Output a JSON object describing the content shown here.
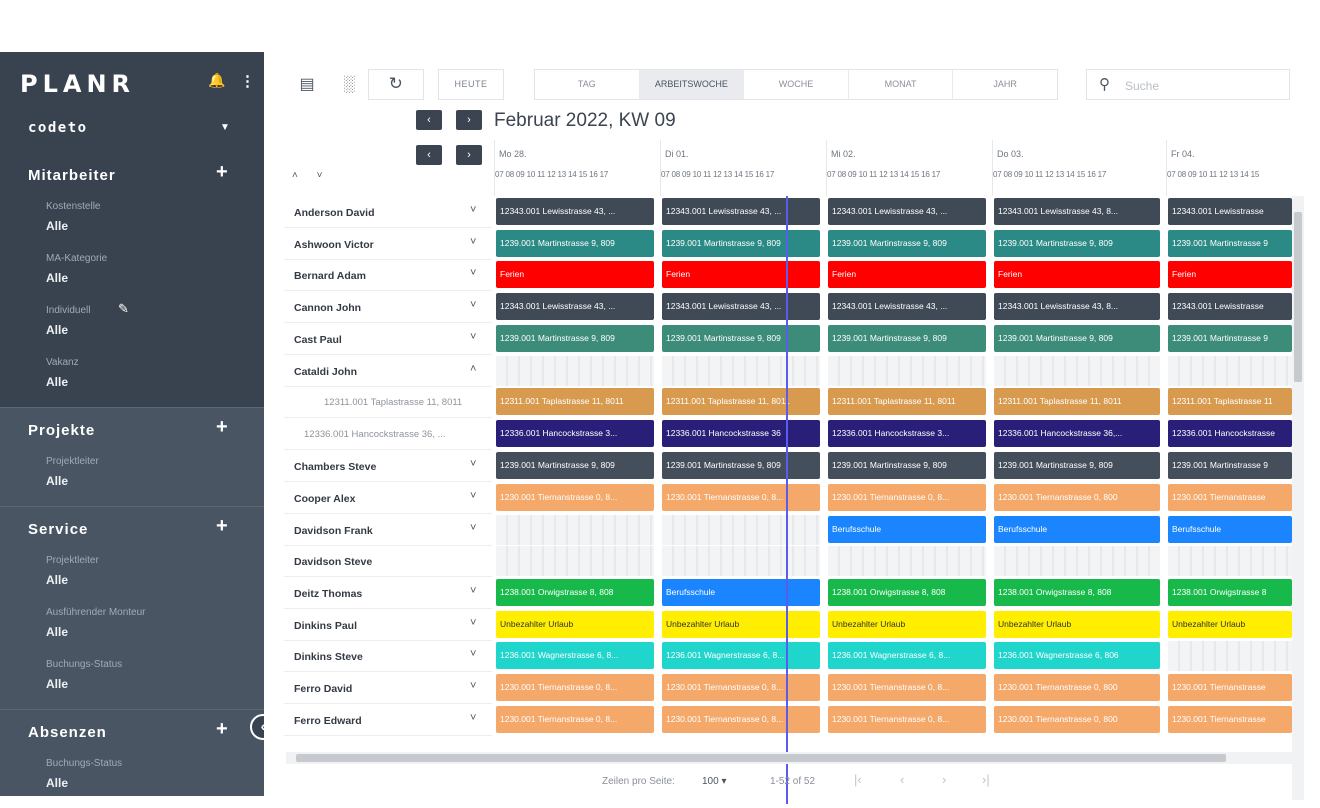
{
  "sidebar": {
    "logo": "PLANR",
    "company": "codeto",
    "sections": [
      {
        "title": "Mitarbeiter",
        "filters": [
          {
            "label": "Kostenstelle",
            "value": "Alle"
          },
          {
            "label": "MA-Kategorie",
            "value": "Alle"
          },
          {
            "label": "Individuell",
            "value": "Alle"
          },
          {
            "label": "Vakanz",
            "value": "Alle"
          }
        ]
      },
      {
        "title": "Projekte",
        "filters": [
          {
            "label": "Projektleiter",
            "value": "Alle"
          }
        ]
      },
      {
        "title": "Service",
        "filters": [
          {
            "label": "Projektleiter",
            "value": "Alle"
          },
          {
            "label": "Ausführender Monteur",
            "value": "Alle"
          },
          {
            "label": "Buchungs-Status",
            "value": "Alle"
          }
        ]
      },
      {
        "title": "Absenzen",
        "filters": [
          {
            "label": "Buchungs-Status",
            "value": "Alle"
          }
        ]
      }
    ]
  },
  "toolbar": {
    "today": "HEUTE",
    "views": [
      "TAG",
      "ARBEITSWOCHE",
      "WOCHE",
      "MONAT",
      "JAHR"
    ],
    "active_view": "ARBEITSWOCHE",
    "search_placeholder": "Suche"
  },
  "period_title": "Februar 2022, KW 09",
  "days": [
    {
      "name": "Mo 28."
    },
    {
      "name": "Di 01."
    },
    {
      "name": "Mi 02."
    },
    {
      "name": "Do 03."
    },
    {
      "name": "Fr 04."
    }
  ],
  "hours_row": "07 08 09 10  11  12  13  14  15  16  17",
  "hours_row_last": "07 08 09 10  11  12  13  14  15",
  "rows": [
    {
      "name": "Anderson David",
      "type": "emp",
      "chev": "down",
      "bars": [
        {
          "text": "12343.001 Lewisstrasse 43, ...",
          "color": "#3f4a56"
        },
        {
          "text": "12343.001 Lewisstrasse 43, ...",
          "color": "#3f4a56"
        },
        {
          "text": "12343.001 Lewisstrasse 43, ...",
          "color": "#3f4a56"
        },
        {
          "text": "12343.001 Lewisstrasse 43, 8...",
          "color": "#3f4a56"
        },
        {
          "text": "12343.001 Lewisstrasse",
          "color": "#3f4a56"
        }
      ]
    },
    {
      "name": "Ashwoon Victor",
      "type": "emp",
      "chev": "down",
      "bars": [
        {
          "text": "1239.001 Martinstrasse 9, 809",
          "color": "#2b8a86"
        },
        {
          "text": "1239.001 Martinstrasse 9, 809",
          "color": "#2b8a86"
        },
        {
          "text": "1239.001 Martinstrasse 9, 809",
          "color": "#2b8a86"
        },
        {
          "text": "1239.001 Martinstrasse 9, 809",
          "color": "#2b8a86"
        },
        {
          "text": "1239.001 Martinstrasse 9",
          "color": "#2b8a86"
        }
      ]
    },
    {
      "name": "Bernard Adam",
      "type": "emp",
      "chev": "down",
      "bars": [
        {
          "text": "Ferien",
          "color": "#ff0000"
        },
        {
          "text": "Ferien",
          "color": "#ff0000"
        },
        {
          "text": "Ferien",
          "color": "#ff0000"
        },
        {
          "text": "Ferien",
          "color": "#ff0000"
        },
        {
          "text": "Ferien",
          "color": "#ff0000"
        }
      ]
    },
    {
      "name": "Cannon John",
      "type": "emp",
      "chev": "down",
      "bars": [
        {
          "text": "12343.001 Lewisstrasse 43, ...",
          "color": "#3f4a56"
        },
        {
          "text": "12343.001 Lewisstrasse 43, ...",
          "color": "#3f4a56"
        },
        {
          "text": "12343.001 Lewisstrasse 43, ...",
          "color": "#3f4a56"
        },
        {
          "text": "12343.001 Lewisstrasse 43, 8...",
          "color": "#3f4a56"
        },
        {
          "text": "12343.001 Lewisstrasse",
          "color": "#3f4a56"
        }
      ]
    },
    {
      "name": "Cast Paul",
      "type": "emp",
      "chev": "down",
      "bars": [
        {
          "text": "1239.001 Martinstrasse 9, 809",
          "color": "#3d8c7a"
        },
        {
          "text": "1239.001 Martinstrasse 9, 809",
          "color": "#3d8c7a"
        },
        {
          "text": "1239.001 Martinstrasse 9, 809",
          "color": "#3d8c7a"
        },
        {
          "text": "1239.001 Martinstrasse 9, 809",
          "color": "#3d8c7a"
        },
        {
          "text": "1239.001 Martinstrasse 9",
          "color": "#3d8c7a"
        }
      ]
    },
    {
      "name": "Cataldi John",
      "type": "emp",
      "chev": "up",
      "bars": []
    },
    {
      "name": "12311.001 Taplastrasse 11, 8011",
      "type": "sub",
      "bars": [
        {
          "text": "12311.001 Taplastrasse 11, 8011",
          "color": "#d89a4e"
        },
        {
          "text": "12311.001 Taplastrasse 11, 8011",
          "color": "#d89a4e"
        },
        {
          "text": "12311.001 Taplastrasse 11, 8011",
          "color": "#d89a4e"
        },
        {
          "text": "12311.001 Taplastrasse 11, 8011",
          "color": "#d89a4e"
        },
        {
          "text": "12311.001 Taplastrasse 11",
          "color": "#d89a4e"
        }
      ]
    },
    {
      "name": "12336.001 Hancockstrasse 36, ...",
      "type": "sub",
      "bars": [
        {
          "text": "12336.001 Hancockstrasse 3...",
          "color": "#2a1f78"
        },
        {
          "text": "12336.001 Hancockstrasse 36",
          "color": "#2a1f78"
        },
        {
          "text": "12336.001 Hancockstrasse 3...",
          "color": "#2a1f78"
        },
        {
          "text": "12336.001 Hancockstrasse 36,...",
          "color": "#2a1f78"
        },
        {
          "text": "12336.001 Hancockstrasse",
          "color": "#2a1f78"
        }
      ]
    },
    {
      "name": "Chambers Steve",
      "type": "emp",
      "chev": "down",
      "bars": [
        {
          "text": "1239.001 Martinstrasse 9, 809",
          "color": "#454f5c"
        },
        {
          "text": "1239.001 Martinstrasse 9, 809",
          "color": "#454f5c"
        },
        {
          "text": "1239.001 Martinstrasse 9, 809",
          "color": "#454f5c"
        },
        {
          "text": "1239.001 Martinstrasse 9, 809",
          "color": "#454f5c"
        },
        {
          "text": "1239.001 Martinstrasse 9",
          "color": "#454f5c"
        }
      ]
    },
    {
      "name": "Cooper Alex",
      "type": "emp",
      "chev": "down",
      "bars": [
        {
          "text": "1230.001 Tiernanstrasse 0, 8...",
          "color": "#f4a86a"
        },
        {
          "text": "1230.001 Tiernanstrasse 0, 8...",
          "color": "#f4a86a"
        },
        {
          "text": "1230.001 Tiernanstrasse 0, 8...",
          "color": "#f4a86a"
        },
        {
          "text": "1230.001 Tiernanstrasse 0, 800",
          "color": "#f4a86a"
        },
        {
          "text": "1230.001 Tiernanstrasse",
          "color": "#f4a86a"
        }
      ]
    },
    {
      "name": "Davidson Frank",
      "type": "emp",
      "chev": "down",
      "bars": [
        null,
        null,
        {
          "text": "Berufsschule",
          "color": "#1a85ff"
        },
        {
          "text": "Berufsschule",
          "color": "#1a85ff"
        },
        {
          "text": "Berufsschule",
          "color": "#1a85ff"
        }
      ]
    },
    {
      "name": "Davidson Steve",
      "type": "emp",
      "chev": "",
      "bars": []
    },
    {
      "name": "Deitz Thomas",
      "type": "emp",
      "chev": "down",
      "bars": [
        {
          "text": "1238.001 Orwigstrasse 8, 808",
          "color": "#16b94a"
        },
        {
          "text": "Berufsschule",
          "color": "#1a85ff"
        },
        {
          "text": "1238.001 Orwigstrasse 8, 808",
          "color": "#16b94a"
        },
        {
          "text": "1238.001 Orwigstrasse 8, 808",
          "color": "#16b94a"
        },
        {
          "text": "1238.001 Orwigstrasse 8",
          "color": "#16b94a"
        }
      ]
    },
    {
      "name": "Dinkins Paul",
      "type": "emp",
      "chev": "down",
      "bars": [
        {
          "text": "Unbezahlter Urlaub",
          "color": "#ffee00"
        },
        {
          "text": "Unbezahlter Urlaub",
          "color": "#ffee00"
        },
        {
          "text": "Unbezahlter Urlaub",
          "color": "#ffee00"
        },
        {
          "text": "Unbezahlter Urlaub",
          "color": "#ffee00"
        },
        {
          "text": "Unbezahlter Urlaub",
          "color": "#ffee00"
        }
      ]
    },
    {
      "name": "Dinkins Steve",
      "type": "emp",
      "chev": "down",
      "bars": [
        {
          "text": "1236.001 Wagnerstrasse 6, 8...",
          "color": "#1fd5cc"
        },
        {
          "text": "1236.001 Wagnerstrasse 6, 8...",
          "color": "#1fd5cc"
        },
        {
          "text": "1236.001 Wagnerstrasse 6, 8...",
          "color": "#1fd5cc"
        },
        {
          "text": "1236.001 Wagnerstrasse 6, 806",
          "color": "#1fd5cc"
        },
        null
      ]
    },
    {
      "name": "Ferro David",
      "type": "emp",
      "chev": "down",
      "bars": [
        {
          "text": "1230.001 Tiernanstrasse 0, 8...",
          "color": "#f4a86a"
        },
        {
          "text": "1230.001 Tiernanstrasse 0, 8...",
          "color": "#f4a86a"
        },
        {
          "text": "1230.001 Tiernanstrasse 0, 8...",
          "color": "#f4a86a"
        },
        {
          "text": "1230.001 Tiernanstrasse 0, 800",
          "color": "#f4a86a"
        },
        {
          "text": "1230.001 Tiernanstrasse",
          "color": "#f4a86a"
        }
      ]
    },
    {
      "name": "Ferro Edward",
      "type": "emp",
      "chev": "down",
      "bars": [
        {
          "text": "1230.001 Tiernanstrasse 0, 8...",
          "color": "#f4a86a"
        },
        {
          "text": "1230.001 Tiernanstrasse 0, 8...",
          "color": "#f4a86a"
        },
        {
          "text": "1230.001 Tiernanstrasse 0, 8...",
          "color": "#f4a86a"
        },
        {
          "text": "1230.001 Tiernanstrasse 0, 800",
          "color": "#f4a86a"
        },
        {
          "text": "1230.001 Tiernanstrasse",
          "color": "#f4a86a"
        }
      ]
    }
  ],
  "footer": {
    "rows_per_page_label": "Zeilen pro Seite:",
    "rows_per_page": "100",
    "range": "1-52 of 52"
  }
}
